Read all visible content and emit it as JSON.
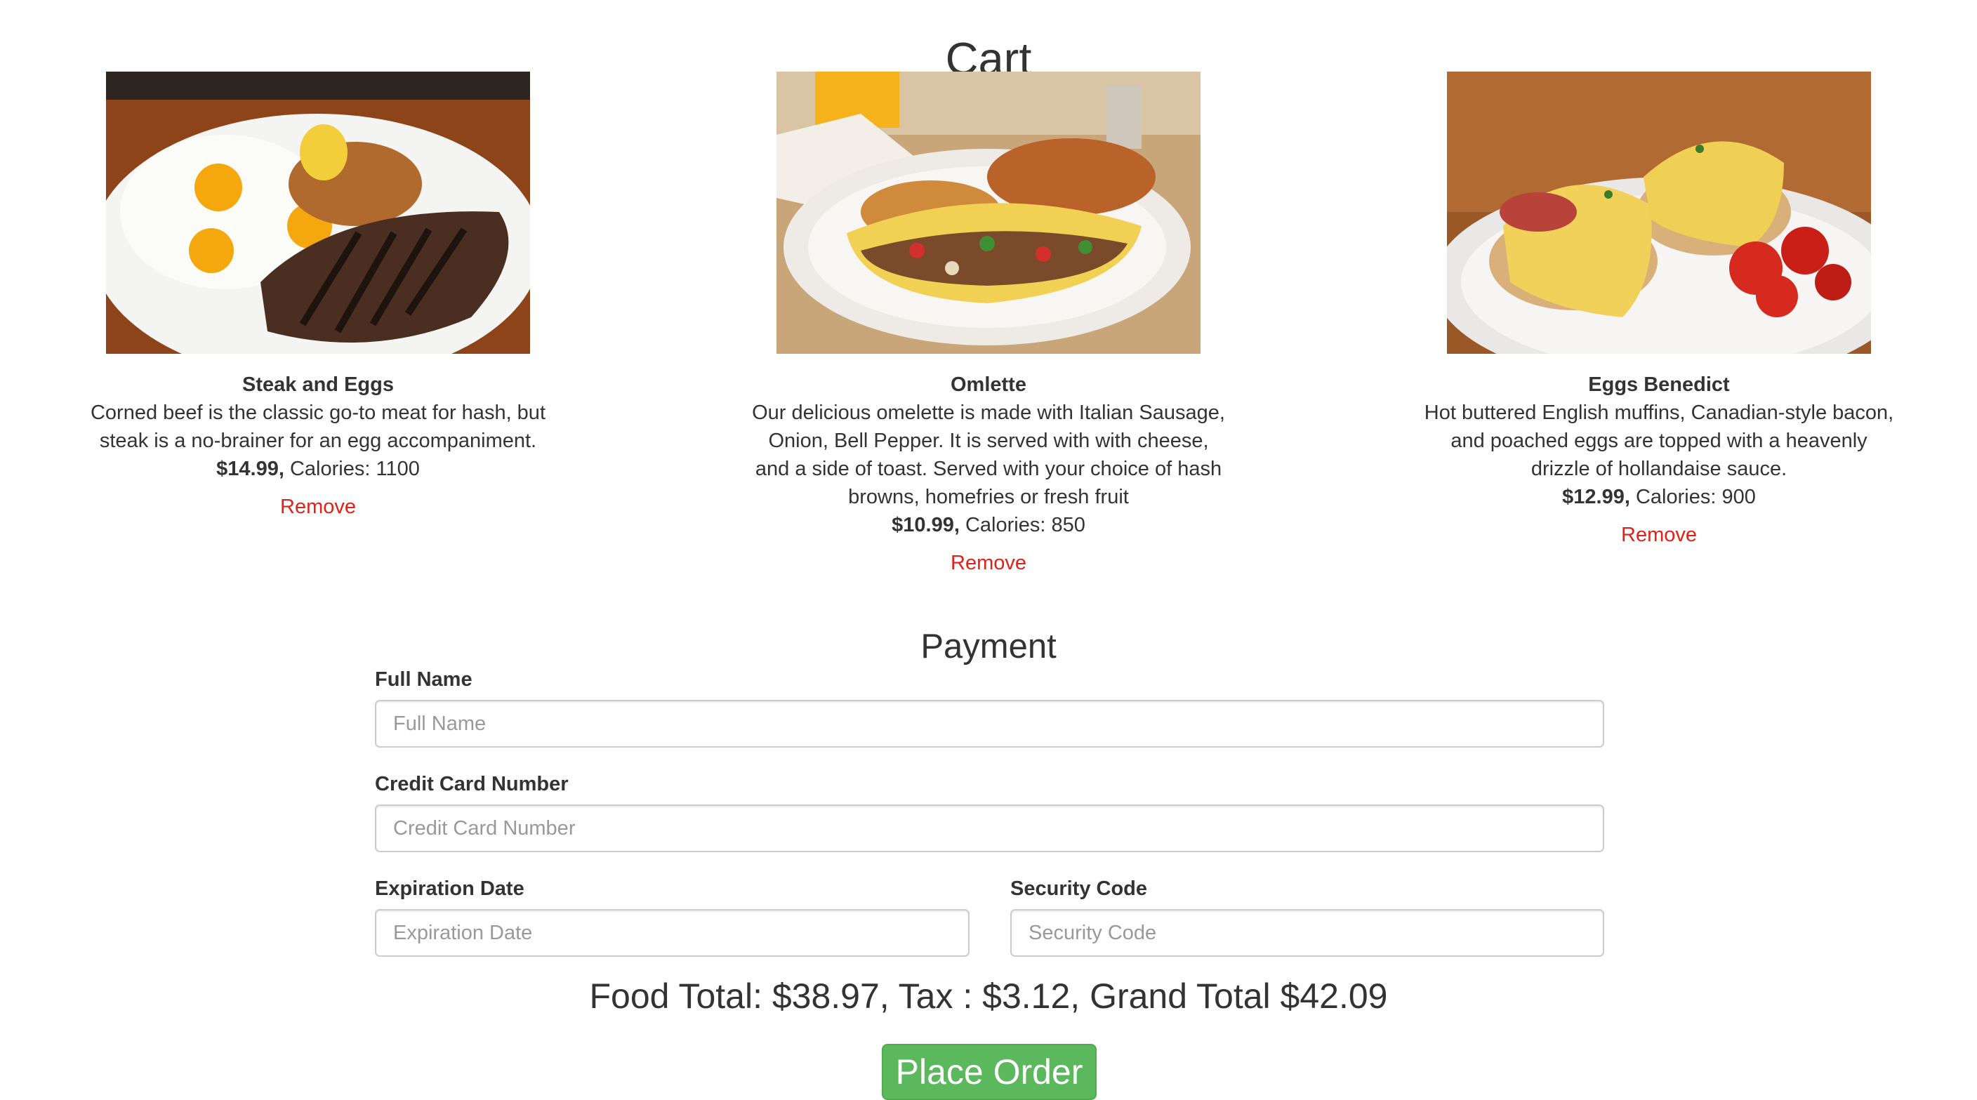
{
  "page": {
    "title": "Cart"
  },
  "cart": {
    "items": [
      {
        "name": "Steak and Eggs",
        "description": "Corned beef is the classic go-to meat for hash, but steak is a no-brainer for an egg accompaniment.",
        "price": "$14.99,",
        "calories": "Calories: 1100",
        "remove_label": "Remove"
      },
      {
        "name": "Omlette",
        "description": "Our delicious omelette is made with Italian Sausage, Onion, Bell Pepper. It is served with with cheese, and a side of toast. Served with your choice of hash browns, homefries or fresh fruit",
        "price": "$10.99,",
        "calories": "Calories: 850",
        "remove_label": "Remove"
      },
      {
        "name": "Eggs Benedict",
        "description": "Hot buttered English muffins, Canadian-style bacon, and poached eggs are topped with a heavenly drizzle of hollandaise sauce.",
        "price": "$12.99,",
        "calories": "Calories: 900",
        "remove_label": "Remove"
      }
    ]
  },
  "payment": {
    "title": "Payment",
    "full_name": {
      "label": "Full Name",
      "placeholder": "Full Name",
      "value": ""
    },
    "card_number": {
      "label": "Credit Card Number",
      "placeholder": "Credit Card Number",
      "value": ""
    },
    "expiration": {
      "label": "Expiration Date",
      "placeholder": "Expiration Date",
      "value": ""
    },
    "security_code": {
      "label": "Security Code",
      "placeholder": "Security Code",
      "value": ""
    }
  },
  "totals": {
    "text": "Food Total: $38.97, Tax : $3.12, Grand Total $42.09"
  },
  "actions": {
    "place_order_label": "Place Order"
  },
  "colors": {
    "remove_link": "#e0221b",
    "place_order_bg": "#5cb85c",
    "text": "#333333"
  }
}
